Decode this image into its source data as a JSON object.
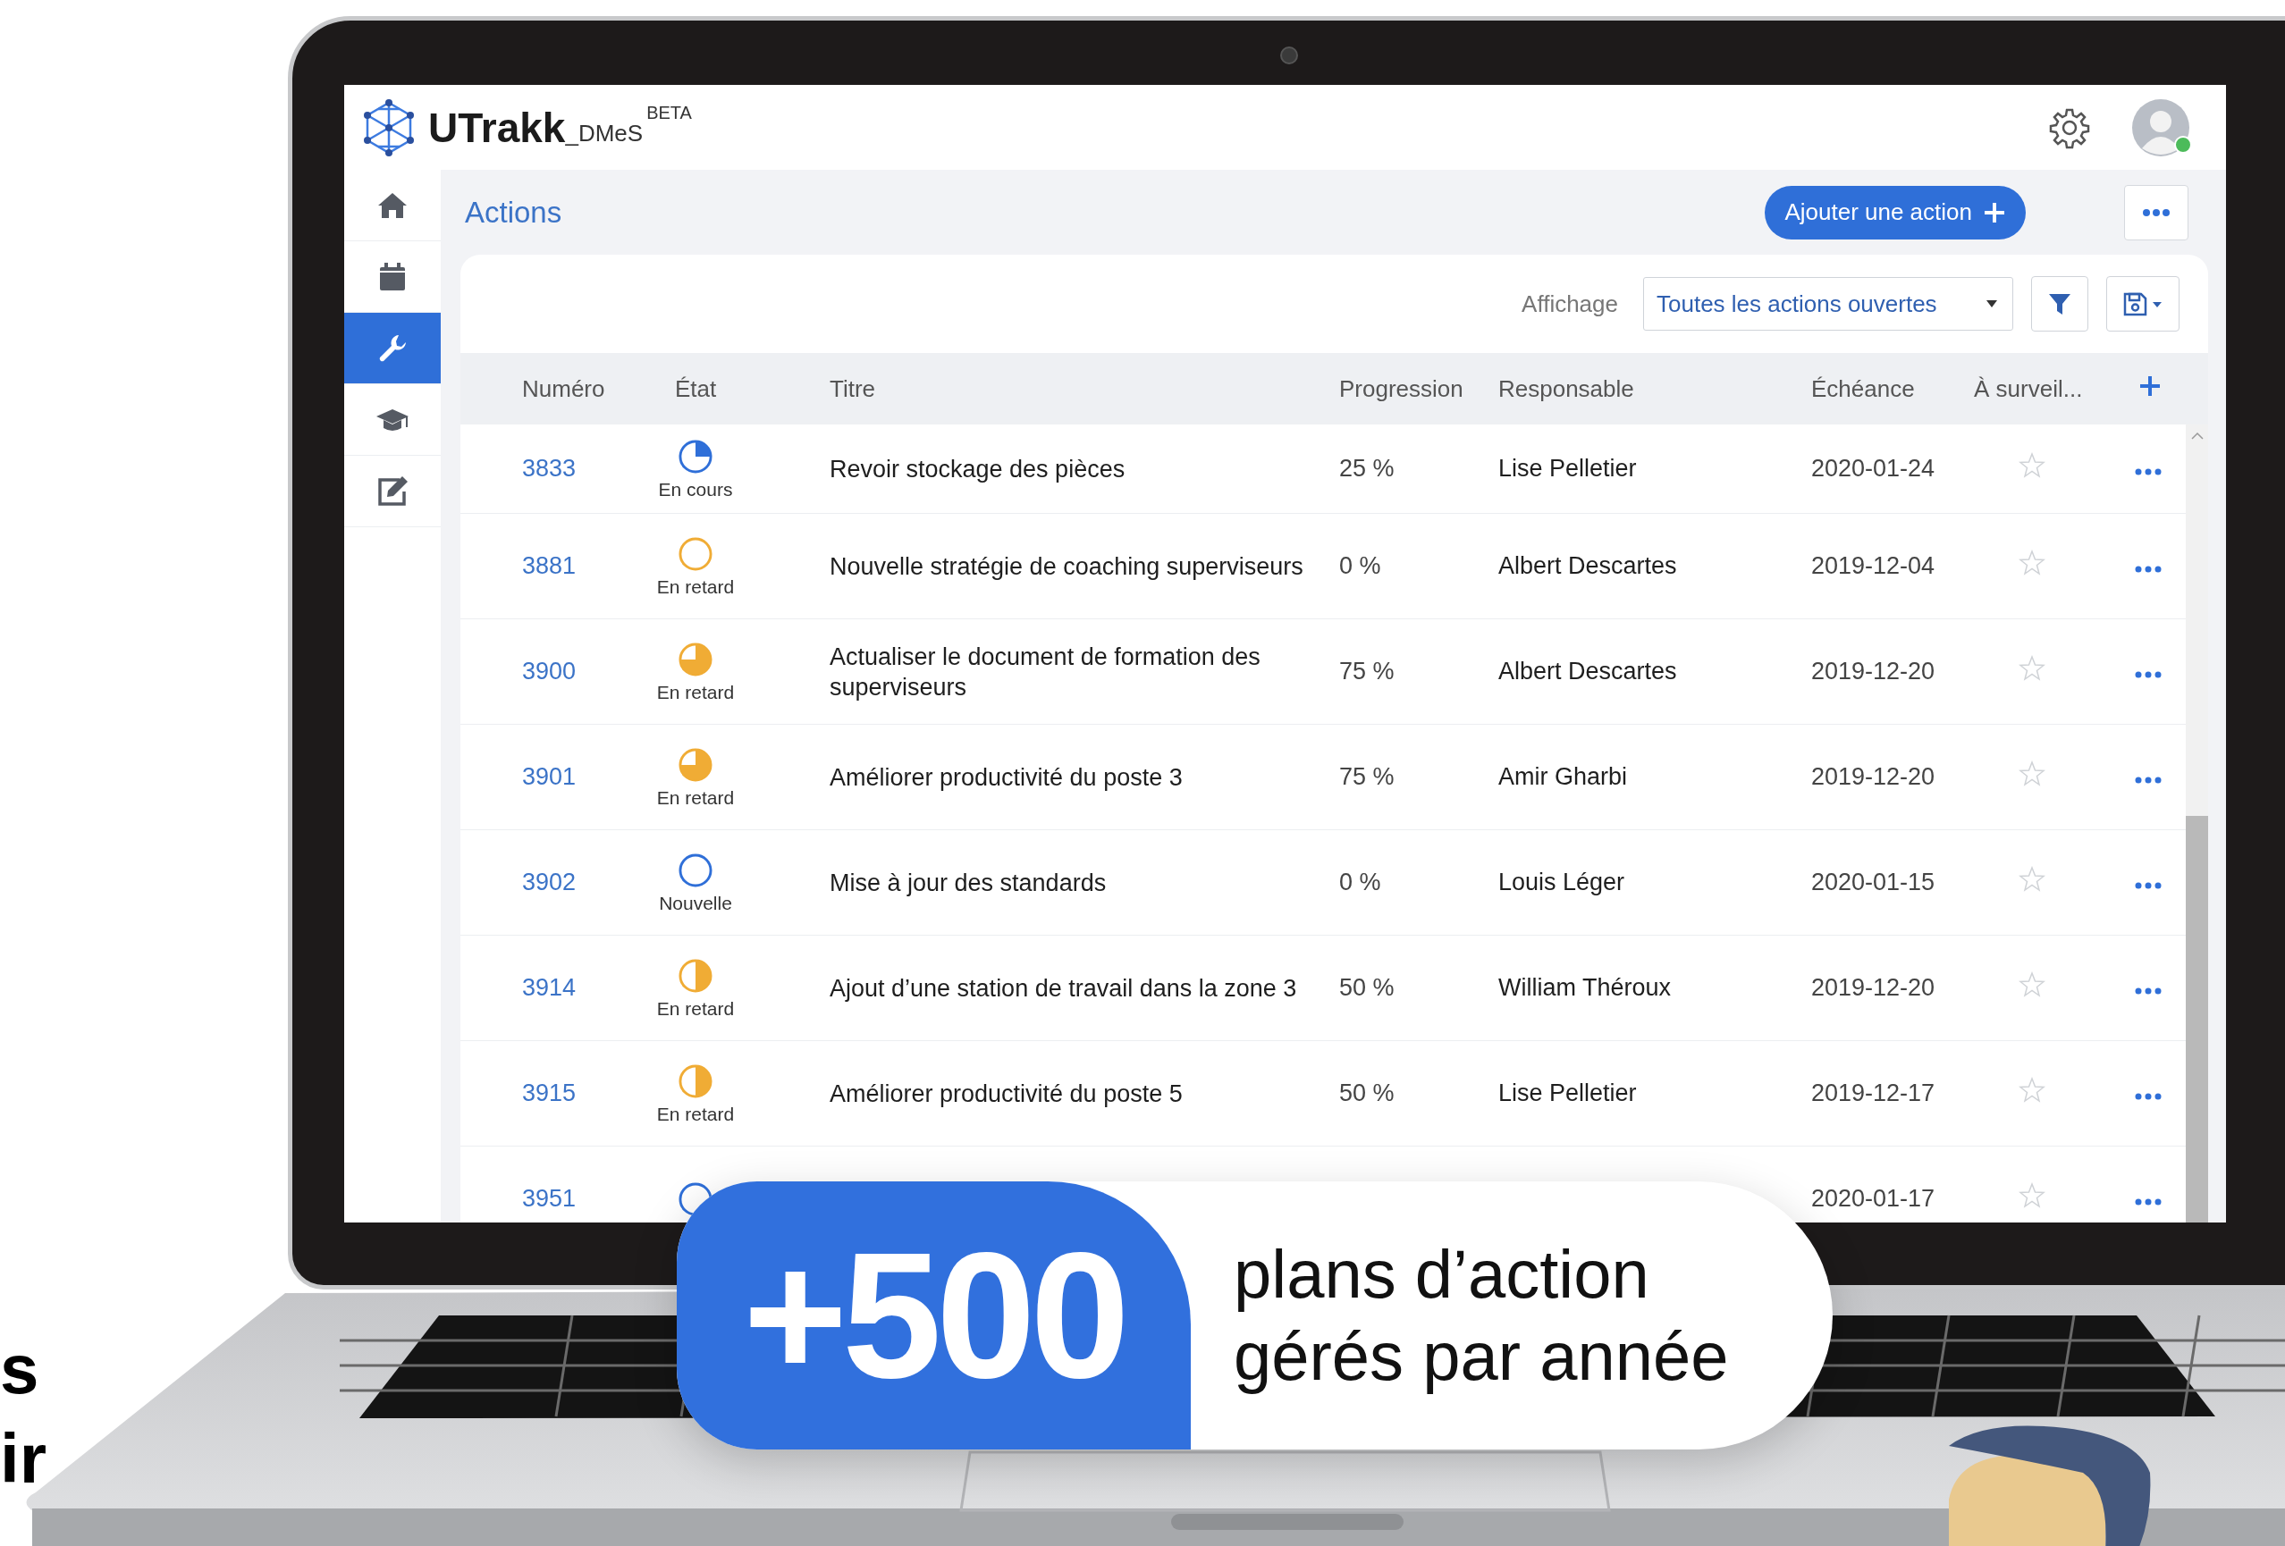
{
  "app": {
    "logo": {
      "name": "UTrakk",
      "suffix": "_DMeS",
      "badge": "BETA"
    },
    "user": {
      "online": true
    },
    "sidebar": [
      {
        "kind": "home",
        "selected": false
      },
      {
        "kind": "calendar",
        "selected": false
      },
      {
        "kind": "tools",
        "selected": true
      },
      {
        "kind": "training",
        "selected": false
      },
      {
        "kind": "edit",
        "selected": false
      }
    ],
    "page_title": "Actions",
    "add_button": "Ajouter une action",
    "view": {
      "label": "Affichage",
      "value": "Toutes les actions ouvertes"
    },
    "table": {
      "columns": [
        "Numéro",
        "État",
        "Titre",
        "Progression",
        "Responsable",
        "Échéance",
        "À surveil..."
      ],
      "rows": [
        {
          "number": "3833",
          "state": {
            "label": "En cours",
            "color": "#2f6fd8",
            "kind": "quarter"
          },
          "title": "Revoir stockage des pièces",
          "progress": "25 %",
          "owner": "Lise Pelletier",
          "due": "2020-01-24",
          "watched": false
        },
        {
          "number": "3881",
          "state": {
            "label": "En retard",
            "color": "#f0ac35",
            "kind": "empty"
          },
          "title": "Nouvelle stratégie de coaching superviseurs",
          "progress": "0 %",
          "owner": "Albert Descartes",
          "due": "2019-12-04",
          "watched": false
        },
        {
          "number": "3900",
          "state": {
            "label": "En retard",
            "color": "#f0ac35",
            "kind": "three_quarters"
          },
          "title": "Actualiser le document de formation des superviseurs",
          "progress": "75 %",
          "owner": "Albert Descartes",
          "due": "2019-12-20",
          "watched": false
        },
        {
          "number": "3901",
          "state": {
            "label": "En retard",
            "color": "#f0ac35",
            "kind": "three_quarters"
          },
          "title": "Améliorer productivité du poste 3",
          "progress": "75 %",
          "owner": "Amir Gharbi",
          "due": "2019-12-20",
          "watched": false
        },
        {
          "number": "3902",
          "state": {
            "label": "Nouvelle",
            "color": "#2f6fd8",
            "kind": "empty"
          },
          "title": "Mise à jour des standards",
          "progress": "0 %",
          "owner": "Louis Léger",
          "due": "2020-01-15",
          "watched": false
        },
        {
          "number": "3914",
          "state": {
            "label": "En retard",
            "color": "#f0ac35",
            "kind": "half"
          },
          "title": "Ajout d’une station de travail dans la zone 3",
          "progress": "50 %",
          "owner": "William Théroux",
          "due": "2019-12-20",
          "watched": false
        },
        {
          "number": "3915",
          "state": {
            "label": "En retard",
            "color": "#f0ac35",
            "kind": "half"
          },
          "title": "Améliorer productivité du poste 5",
          "progress": "50 %",
          "owner": "Lise Pelletier",
          "due": "2019-12-17",
          "watched": false
        },
        {
          "number": "3951",
          "state": {
            "color": "#2f6fd8",
            "kind": "empty"
          },
          "due": "2020-01-17",
          "watched": false
        }
      ]
    }
  },
  "banner": {
    "number": "+500",
    "caption": "plans d’action gérés par année"
  },
  "side_text": [
    "s",
    "ir"
  ]
}
